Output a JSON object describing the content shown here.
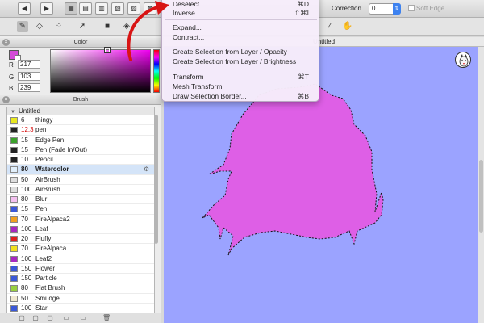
{
  "toolbar": {
    "correction_label": "Correction",
    "correction_value": "0",
    "soft_edge_label": "Soft Edge"
  },
  "color_panel": {
    "title": "Color",
    "r_label": "R",
    "r_value": "217",
    "g_label": "G",
    "g_value": "103",
    "b_label": "B",
    "b_value": "239",
    "current_color": "#d44ad8"
  },
  "brush_panel": {
    "title": "Brush",
    "group_name": "Untitled",
    "items": [
      {
        "size": "6",
        "name": "thingy",
        "color": "#e8e820"
      },
      {
        "size": "12.3",
        "name": "pen",
        "color": "#222222",
        "size_red": true
      },
      {
        "size": "15",
        "name": "Edge Pen",
        "color": "#3aa12a"
      },
      {
        "size": "15",
        "name": "Pen (Fade In/Out)",
        "color": "#222222"
      },
      {
        "size": "10",
        "name": "Pencil",
        "color": "#222222"
      },
      {
        "size": "80",
        "name": "Watercolor",
        "color": "#e0eefa",
        "selected": true
      },
      {
        "size": "50",
        "name": "AirBrush",
        "color": "#dddddd"
      },
      {
        "size": "100",
        "name": "AirBrush",
        "color": "#dddddd"
      },
      {
        "size": "80",
        "name": "Blur",
        "color": "#f4c0f0"
      },
      {
        "size": "15",
        "name": "Pen",
        "color": "#3a58d8"
      },
      {
        "size": "70",
        "name": "FireAlpaca2",
        "color": "#f0a020"
      },
      {
        "size": "100",
        "name": "Leaf",
        "color": "#a828c0"
      },
      {
        "size": "20",
        "name": "Fluffy",
        "color": "#e02020"
      },
      {
        "size": "70",
        "name": "FireAlpaca",
        "color": "#f0e020"
      },
      {
        "size": "100",
        "name": "Leaf2",
        "color": "#a828c0"
      },
      {
        "size": "150",
        "name": "Flower",
        "color": "#3a58d8"
      },
      {
        "size": "150",
        "name": "Particle",
        "color": "#3a58d8"
      },
      {
        "size": "80",
        "name": "Flat Brush",
        "color": "#98d040"
      },
      {
        "size": "50",
        "name": "Smudge",
        "color": "#f0e8d0"
      },
      {
        "size": "100",
        "name": "Star",
        "color": "#3a58d8"
      }
    ]
  },
  "document": {
    "tab_title": "Untitled",
    "canvas_color": "#9ba3ff",
    "shape_color": "#de5fe6"
  },
  "menu": {
    "items": [
      {
        "label": "Deselect",
        "shortcut": "⌘D"
      },
      {
        "label": "Inverse",
        "shortcut": "⇧⌘I"
      },
      {
        "label": "Expand...",
        "shortcut": ""
      },
      {
        "label": "Contract...",
        "shortcut": ""
      },
      {
        "label": "Create Selection from Layer / Opacity",
        "shortcut": ""
      },
      {
        "label": "Create Selection from Layer / Brightness",
        "shortcut": ""
      },
      {
        "label": "Transform",
        "shortcut": "⌘T"
      },
      {
        "label": "Mesh Transform",
        "shortcut": ""
      },
      {
        "label": "Draw Selection Border...",
        "shortcut": "⌘B"
      }
    ]
  },
  "icons": {
    "toolbar": [
      "nav-back-icon",
      "nav-forward-icon",
      "view-icon",
      "grid-icon",
      "grid-icon",
      "grid-icon",
      "grid-icon",
      "grid-icon"
    ],
    "tools": [
      "brush-icon",
      "eraser-icon",
      "dots-icon",
      "move-icon",
      "fill-icon",
      "bucket-icon",
      "eyedropper-icon",
      "hand-icon"
    ]
  }
}
